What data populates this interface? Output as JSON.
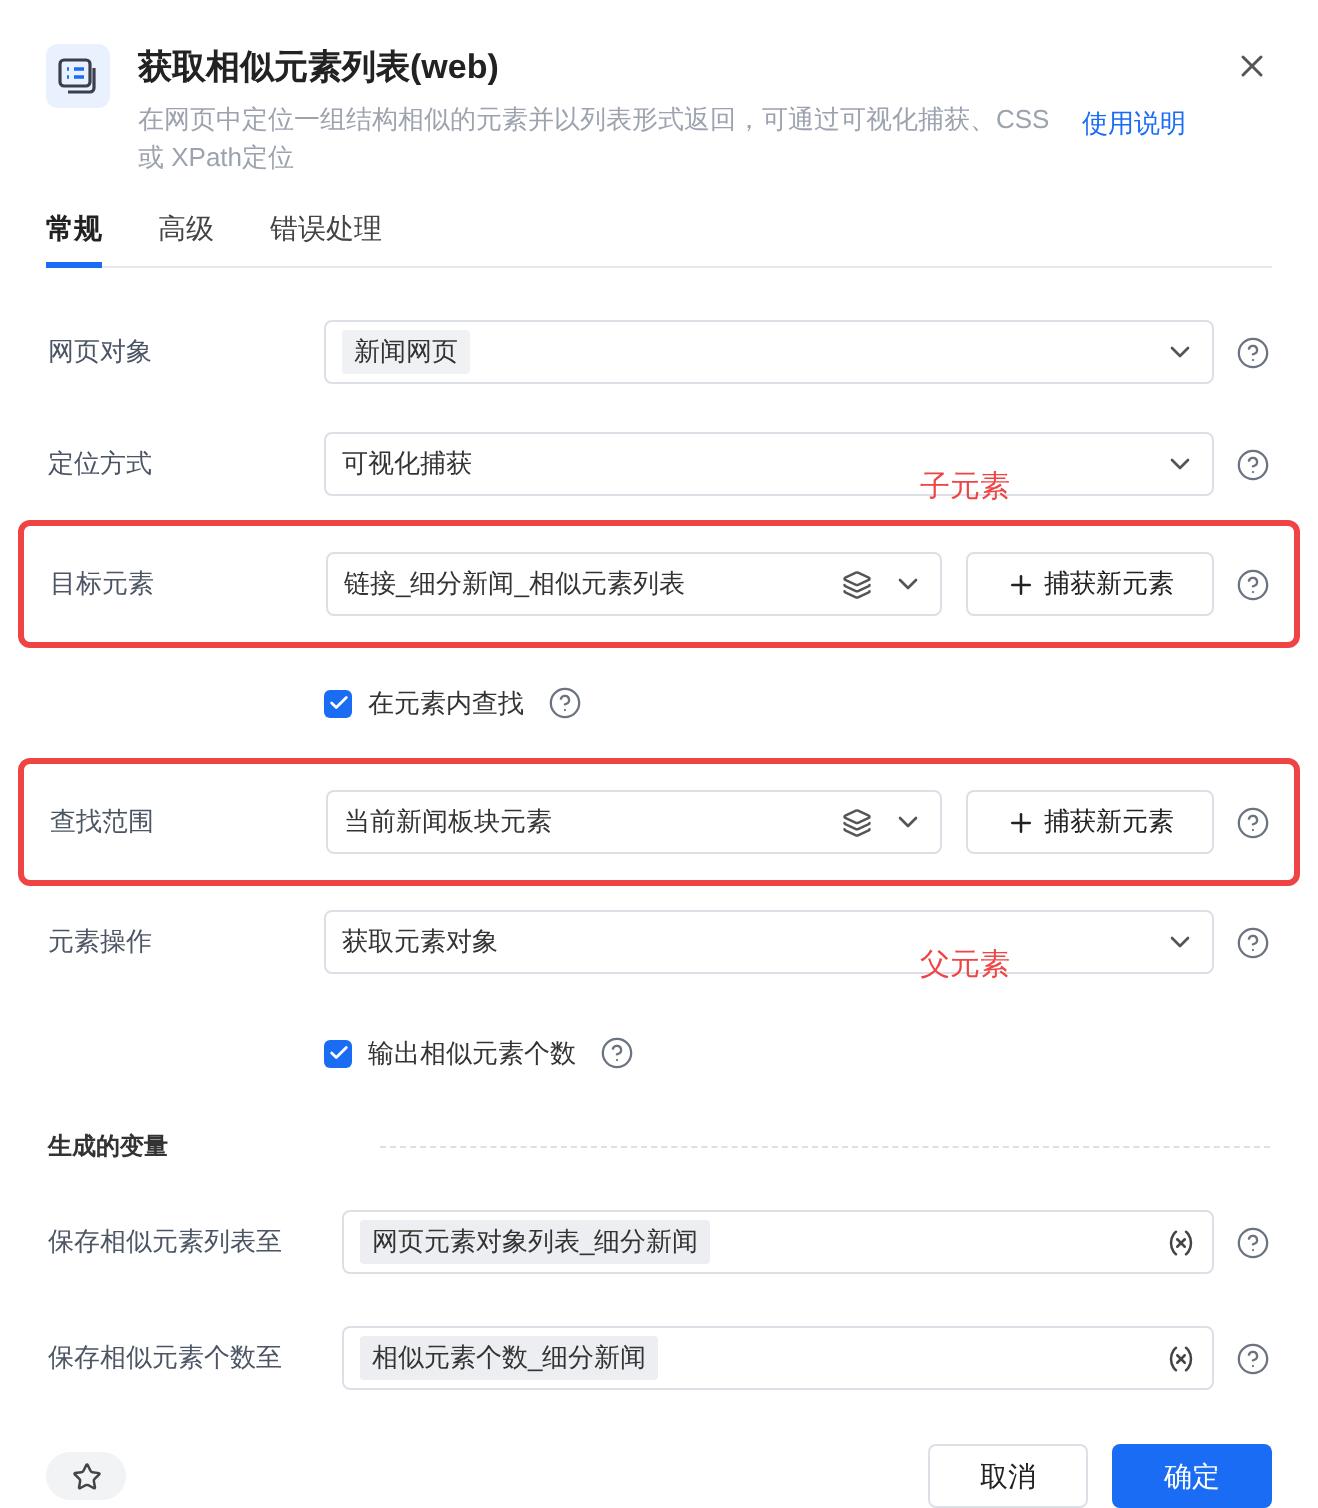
{
  "header": {
    "title": "获取相似元素列表(web)",
    "description": "在网页中定位一组结构相似的元素并以列表形式返回，可通过可视化捕获、CSS 或 XPath定位",
    "help_link": "使用说明"
  },
  "tabs": [
    {
      "label": "常规",
      "selected": true
    },
    {
      "label": "高级",
      "selected": false
    },
    {
      "label": "错误处理",
      "selected": false
    }
  ],
  "rows": [
    {
      "kind": "select",
      "label": "网页对象",
      "value": "新闻网页",
      "tagged": true,
      "highlighted": false
    },
    {
      "kind": "select",
      "label": "定位方式",
      "value": "可视化捕获",
      "tagged": false,
      "highlighted": false,
      "annotation": "子元素"
    },
    {
      "kind": "element",
      "label": "目标元素",
      "value": "链接_细分新闻_相似元素列表",
      "button": "捕获新元素",
      "highlighted": true
    },
    {
      "kind": "checkbox",
      "label": "在元素内查找",
      "checked": true
    },
    {
      "kind": "element",
      "label": "查找范围",
      "value": "当前新闻板块元素",
      "button": "捕获新元素",
      "highlighted": true
    },
    {
      "kind": "select",
      "label": "元素操作",
      "value": "获取元素对象",
      "tagged": false,
      "highlighted": false,
      "annotation": "父元素"
    },
    {
      "kind": "checkbox",
      "label": "输出相似元素个数",
      "checked": true
    }
  ],
  "variables": {
    "title": "生成的变量",
    "rows": [
      {
        "label": "保存相似元素列表至",
        "value": "网页元素对象列表_细分新闻"
      },
      {
        "label": "保存相似元素个数至",
        "value": "相似元素个数_细分新闻"
      }
    ]
  },
  "footer": {
    "cancel": "取消",
    "confirm": "确定"
  }
}
